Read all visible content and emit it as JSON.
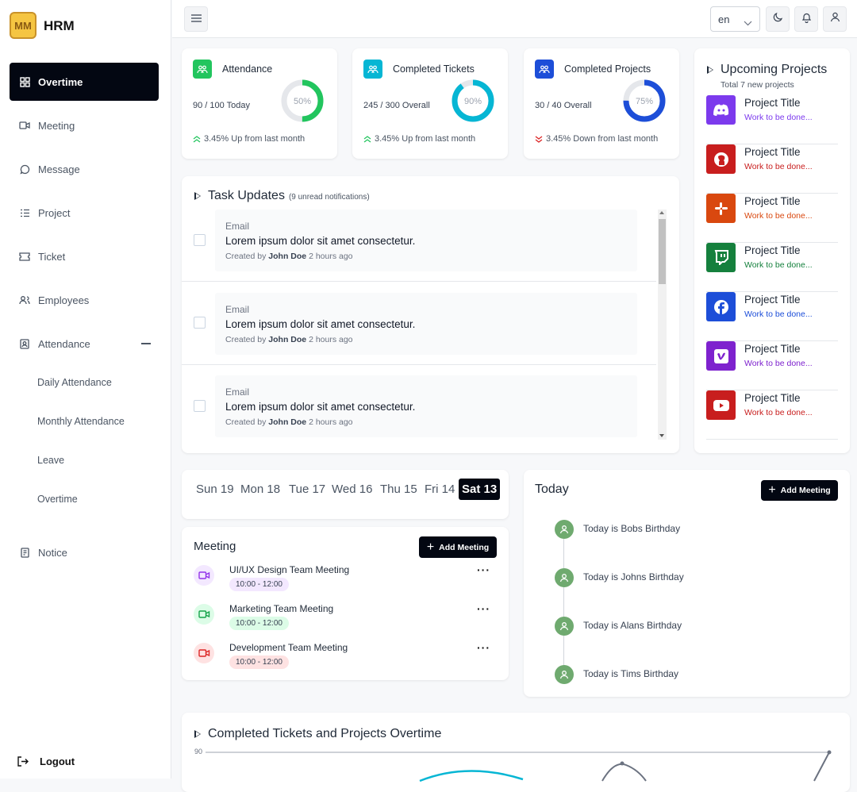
{
  "app": {
    "brand": "HRM",
    "logo_text": "MM"
  },
  "sidebar": {
    "items": [
      {
        "label": "Overtime",
        "icon": "grid-icon"
      },
      {
        "label": "Meeting",
        "icon": "video-icon"
      },
      {
        "label": "Message",
        "icon": "chat-icon"
      },
      {
        "label": "Project",
        "icon": "list-icon"
      },
      {
        "label": "Ticket",
        "icon": "ticket-icon"
      },
      {
        "label": "Employees",
        "icon": "users-icon"
      },
      {
        "label": "Attendance",
        "icon": "contact-icon"
      }
    ],
    "sub_items": [
      "Daily Attendance",
      "Monthly Attendance",
      "Leave",
      "Overtime"
    ],
    "notice": "Notice",
    "logout": "Logout"
  },
  "topbar": {
    "language": "en"
  },
  "stats": [
    {
      "title": "Attendance",
      "value": "90 / 100 Today",
      "percent": "50%",
      "fraction": 0.5,
      "trend": "3.45% Up from last month",
      "direction": "up",
      "color": "#22c55e"
    },
    {
      "title": "Completed Tickets",
      "value": "245 / 300 Overall",
      "percent": "90%",
      "fraction": 0.9,
      "trend": "3.45% Up from last month",
      "direction": "up",
      "color": "#06b6d4"
    },
    {
      "title": "Completed Projects",
      "value": "30 / 40 Overall",
      "percent": "75%",
      "fraction": 0.75,
      "trend": "3.45% Down from last month",
      "direction": "down",
      "color": "#1d4ed8"
    }
  ],
  "task_updates": {
    "title": "Task Updates",
    "count_note": "(9 unread notifications)",
    "items": [
      {
        "type": "Email",
        "message": "Lorem ipsum dolor sit amet consectetur.",
        "created_prefix": "Created by",
        "author": "John Doe",
        "time": "2 hours ago"
      },
      {
        "type": "Email",
        "message": "Lorem ipsum dolor sit amet consectetur.",
        "created_prefix": "Created by",
        "author": "John Doe",
        "time": "2 hours ago"
      },
      {
        "type": "Email",
        "message": "Lorem ipsum dolor sit amet consectetur.",
        "created_prefix": "Created by",
        "author": "John Doe",
        "time": "2 hours ago"
      }
    ]
  },
  "upcoming": {
    "title": "Upcoming Projects",
    "subtitle": "Total 7 new projects",
    "projects": [
      {
        "title": "Project Title",
        "status": "Work to be done...",
        "icon": "discord-icon",
        "bg": "#7c3aed",
        "status_color": "#7c3aed"
      },
      {
        "title": "Project Title",
        "status": "Work to be done...",
        "icon": "github-icon",
        "bg": "#c81e1e",
        "status_color": "#c81e1e"
      },
      {
        "title": "Project Title",
        "status": "Work to be done...",
        "icon": "slack-icon",
        "bg": "#d9480f",
        "status_color": "#d9480f"
      },
      {
        "title": "Project Title",
        "status": "Work to be done...",
        "icon": "twitch-icon",
        "bg": "#15803d",
        "status_color": "#15803d"
      },
      {
        "title": "Project Title",
        "status": "Work to be done...",
        "icon": "facebook-icon",
        "bg": "#1d4ed8",
        "status_color": "#1d4ed8"
      },
      {
        "title": "Project Title",
        "status": "Work to be done...",
        "icon": "vimeo-icon",
        "bg": "#7e22ce",
        "status_color": "#7e22ce"
      },
      {
        "title": "Project Title",
        "status": "Work to be done...",
        "icon": "youtube-icon",
        "bg": "#c81e1e",
        "status_color": "#c81e1e"
      }
    ]
  },
  "days": [
    "Sun 19",
    "Mon 18",
    "Tue 17",
    "Wed 16",
    "Thu 15",
    "Fri 14",
    "Sat 13"
  ],
  "meeting": {
    "title": "Meeting",
    "add_label": "Add Meeting",
    "items": [
      {
        "title": "UI/UX Design Team Meeting",
        "time": "10:00 - 12:00",
        "color": "#9333ea",
        "bg": "#f3e8ff"
      },
      {
        "title": "Marketing Team Meeting",
        "time": "10:00 - 12:00",
        "color": "#16a34a",
        "bg": "#dcfce7"
      },
      {
        "title": "Development Team Meeting",
        "time": "10:00 - 12:00",
        "color": "#dc2626",
        "bg": "#fee2e2"
      }
    ]
  },
  "today": {
    "title": "Today",
    "add_label": "Add Meeting",
    "events": [
      "Today is Bobs Birthday",
      "Today is Johns Birthday",
      "Today is Alans Birthday",
      "Today is Tims Birthday"
    ]
  },
  "overtime_chart": {
    "title": "Completed Tickets and Projects Overtime",
    "y_tick": "90"
  }
}
